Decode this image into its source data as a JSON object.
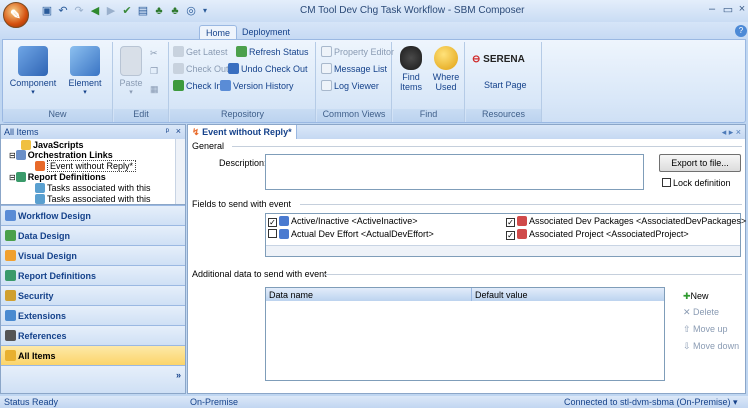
{
  "window": {
    "title": "CM Tool Dev Chg Task Workflow - SBM Composer"
  },
  "ribbon_tabs": [
    "Home",
    "Deployment"
  ],
  "ribbon": {
    "new_group": {
      "label": "New",
      "component": "Component",
      "element": "Element"
    },
    "edit_group": {
      "label": "Edit",
      "paste": "Paste"
    },
    "repository_group": {
      "label": "Repository",
      "get_latest": "Get Latest",
      "refresh_status": "Refresh Status",
      "check_out": "Check Out",
      "undo_check_out": "Undo Check Out",
      "check_in": "Check In",
      "version_history": "Version History"
    },
    "common_views_group": {
      "label": "Common Views",
      "property_editor": "Property Editor",
      "message_list": "Message List",
      "log_viewer": "Log Viewer"
    },
    "find_group": {
      "label": "Find",
      "find_items_1": "Find",
      "find_items_2": "Items",
      "where_used_1": "Where",
      "where_used_2": "Used"
    },
    "resources_group": {
      "label": "Resources",
      "brand": "SERENA",
      "start_page": "Start Page"
    }
  },
  "left_pane": {
    "header": "All Items",
    "pin": "ᵖ",
    "close": "×",
    "tree": [
      {
        "label": "JavaScripts"
      },
      {
        "label": "Orchestration Links"
      },
      {
        "label": "Event without Reply*"
      },
      {
        "label": "Report Definitions"
      },
      {
        "label": "Tasks associated with this"
      },
      {
        "label": "Tasks associated with this"
      }
    ],
    "nav": [
      "Workflow Design",
      "Data Design",
      "Visual Design",
      "Report Definitions",
      "Security",
      "Extensions",
      "References",
      "All Items"
    ],
    "more": "»"
  },
  "document": {
    "tab_title": "Event without Reply*",
    "nav_arrows": "◂ ▸ ×",
    "general_label": "General",
    "description_label": "Description:",
    "description_value": "",
    "export_button": "Export to file...",
    "lock_definition": "Lock definition",
    "fields_label": "Fields to send with event",
    "fields": [
      {
        "label": "Active/Inactive  <ActiveInactive>",
        "checked": true
      },
      {
        "label": "Associated Dev Packages  <AssociatedDevPackages>",
        "checked": true
      },
      {
        "label": "Actual Dev Effort  <ActualDevEffort>",
        "checked": false
      },
      {
        "label": "Associated Project  <AssociatedProject>",
        "checked": true
      }
    ],
    "additional_label": "Additional data to send with event",
    "grid_headers": [
      "Data name",
      "Default value"
    ],
    "actions": {
      "new": "New",
      "delete": "Delete",
      "move_up": "Move up",
      "move_down": "Move down"
    }
  },
  "status_bar": {
    "left": "Status Ready",
    "middle": "On-Premise",
    "right": "Connected to stl-dvm-sbma (On-Premise)  ▾"
  },
  "colors": {
    "accent": "#15428b",
    "selection": "#fbd46a"
  }
}
